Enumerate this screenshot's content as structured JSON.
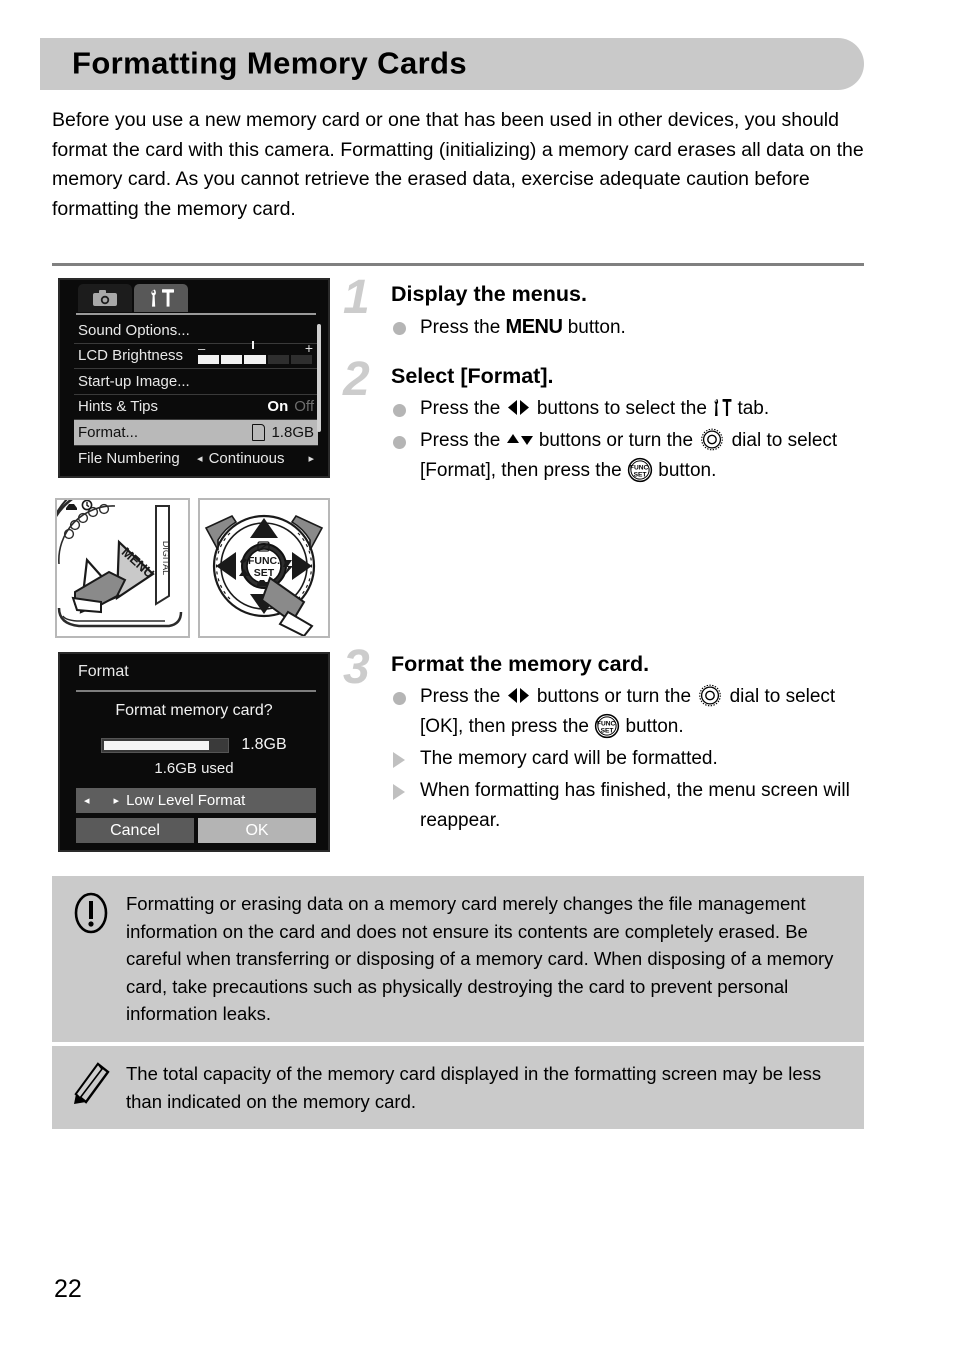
{
  "page": {
    "title": "Formatting Memory Cards",
    "number": "22",
    "intro": "Before you use a new memory card or one that has been used in other devices, you should format the card with this camera. Formatting (initializing) a memory card erases all data on the memory card. As you cannot retrieve the erased data, exercise adequate caution before formatting the memory card."
  },
  "colors": {
    "header_band": "#c9c9c9",
    "callout_bg": "#cacaca",
    "step_number": "#cccccc",
    "divider": "#808080",
    "lcd_bg": "#0b0b0b",
    "menu_selected": "#b9b9b9"
  },
  "menu_screen": {
    "tabs": [
      {
        "icon": "camera-icon",
        "active": false
      },
      {
        "icon": "settings-wrench-hammer-icon",
        "active": true
      }
    ],
    "rows": [
      {
        "label": "Sound Options...",
        "value": "",
        "type": "submenu",
        "selected": false
      },
      {
        "label": "LCD Brightness",
        "value": "",
        "type": "slider",
        "selected": false,
        "slider": {
          "minus": "–",
          "plus": "+",
          "segments": 5,
          "filled": 3
        }
      },
      {
        "label": "Start-up Image...",
        "value": "",
        "type": "submenu",
        "selected": false
      },
      {
        "label": "Hints & Tips",
        "type": "toggle",
        "selected": false,
        "toggle": {
          "on": "On",
          "off": "Off",
          "state": "On"
        }
      },
      {
        "label": "Format...",
        "value": "1.8GB",
        "type": "card",
        "selected": true
      },
      {
        "label": "File Numbering",
        "value": "Continuous",
        "type": "spinner",
        "selected": false,
        "spinner": {
          "left": "◂",
          "right": "▸"
        }
      }
    ]
  },
  "format_screen": {
    "title": "Format",
    "question": "Format memory card?",
    "total_capacity": "1.8GB",
    "used": "1.6GB used",
    "bar_fill_percent": 86,
    "low_level_format": {
      "left_arrow": "◂",
      "check_arrow": "▸",
      "label": "Low Level Format"
    },
    "buttons": [
      {
        "label": "Cancel",
        "selected": false
      },
      {
        "label": "OK",
        "selected": true
      }
    ]
  },
  "photos": [
    {
      "name": "menu-button-photo",
      "caption": "MENU"
    },
    {
      "name": "control-dial-photo",
      "caption": "FUNC. SET"
    }
  ],
  "steps": [
    {
      "number": "1",
      "heading": "Display the menus.",
      "items": [
        {
          "marker": "dot",
          "parts": [
            {
              "type": "text",
              "value": "Press the "
            },
            {
              "type": "menu-word",
              "value": "MENU"
            },
            {
              "type": "text",
              "value": " button."
            }
          ]
        }
      ]
    },
    {
      "number": "2",
      "heading": "Select [Format].",
      "items": [
        {
          "marker": "dot",
          "parts": [
            {
              "type": "text",
              "value": "Press the "
            },
            {
              "type": "icon",
              "value": "left-right-buttons-icon"
            },
            {
              "type": "text",
              "value": " buttons to select the "
            },
            {
              "type": "icon",
              "value": "settings-tab-icon"
            },
            {
              "type": "text",
              "value": " tab."
            }
          ]
        },
        {
          "marker": "dot",
          "parts": [
            {
              "type": "text",
              "value": "Press the "
            },
            {
              "type": "icon",
              "value": "up-down-buttons-icon"
            },
            {
              "type": "text",
              "value": " buttons or turn the "
            },
            {
              "type": "icon",
              "value": "control-dial-icon"
            },
            {
              "type": "text",
              "value": " dial to select [Format], then press the "
            },
            {
              "type": "icon",
              "value": "func-set-button-icon"
            },
            {
              "type": "text",
              "value": " button."
            }
          ]
        }
      ]
    },
    {
      "number": "3",
      "heading": "Format the memory card.",
      "items": [
        {
          "marker": "dot",
          "parts": [
            {
              "type": "text",
              "value": "Press the "
            },
            {
              "type": "icon",
              "value": "left-right-buttons-icon"
            },
            {
              "type": "text",
              "value": " buttons or turn the "
            },
            {
              "type": "icon",
              "value": "control-dial-icon"
            },
            {
              "type": "text",
              "value": " dial to select [OK], then press the "
            },
            {
              "type": "icon",
              "value": "func-set-button-icon"
            },
            {
              "type": "text",
              "value": " button."
            }
          ]
        },
        {
          "marker": "triangle",
          "parts": [
            {
              "type": "text",
              "value": "The memory card will be formatted."
            }
          ]
        },
        {
          "marker": "triangle",
          "parts": [
            {
              "type": "text",
              "value": "When formatting has finished, the menu screen will reappear."
            }
          ]
        }
      ]
    }
  ],
  "callouts": [
    {
      "icon": "warning-exclamation-icon",
      "text": "Formatting or erasing data on a memory card merely changes the file management information on the card and does not ensure its contents are completely erased. Be careful when transferring or disposing of a memory card. When disposing of a memory card, take precautions such as physically destroying the card to prevent personal information leaks."
    },
    {
      "icon": "note-pencil-icon",
      "text": "The total capacity of the memory card displayed in the formatting screen may be less than indicated on the memory card."
    }
  ]
}
